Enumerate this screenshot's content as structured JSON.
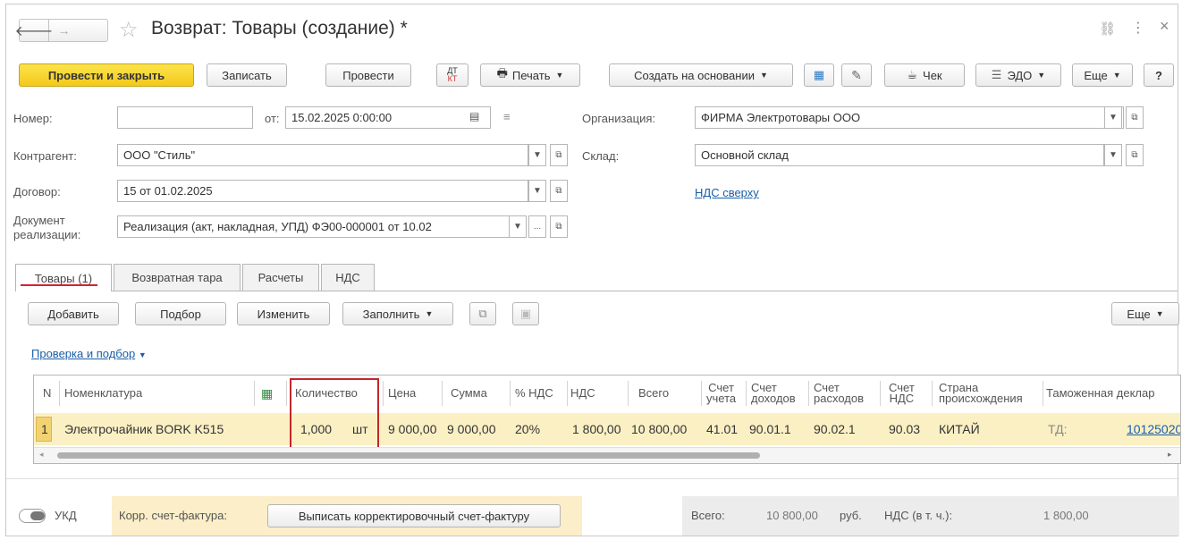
{
  "titlebar": {
    "title": "Возврат: Товары (создание) *",
    "back": "🡐",
    "forward": "→",
    "star": "☆",
    "link_icon": "⛓",
    "more_icon": "⋮",
    "close": "×"
  },
  "toolbar": {
    "post_close": "Провести и закрыть",
    "save": "Записать",
    "post": "Провести",
    "dtkt_top": "ДТ",
    "dtkt_bottom": "КТ",
    "print": "Печать",
    "create_based": "Создать на основании",
    "receipt": "Чек",
    "edo": "ЭДО",
    "more": "Еще",
    "help": "?"
  },
  "form": {
    "number_label": "Номер:",
    "number_value": "",
    "date_label": "от:",
    "date_value": "15.02.2025  0:00:00",
    "org_label": "Организация:",
    "org_value": "ФИРМА Электротовары ООО",
    "counterparty_label": "Контрагент:",
    "counterparty_value": "ООО \"Стиль\"",
    "warehouse_label": "Склад:",
    "warehouse_value": "Основной склад",
    "contract_label": "Договор:",
    "contract_value": "15 от 01.02.2025",
    "vat_link": "НДС сверху",
    "sale_doc_label_1": "Документ",
    "sale_doc_label_2": "реализации:",
    "sale_doc_value": "Реализация (акт, накладная, УПД) ФЭ00-000001 от 10.02",
    "dots": "..."
  },
  "tabs": [
    "Товары (1)",
    "Возвратная тара",
    "Расчеты",
    "НДС"
  ],
  "table_toolbar": {
    "add": "Добавить",
    "pick": "Подбор",
    "edit": "Изменить",
    "fill": "Заполнить",
    "more": "Еще",
    "check_link": "Проверка и подбор"
  },
  "table": {
    "headers": {
      "n": "N",
      "item": "Номенклатура",
      "qty": "Количество",
      "price": "Цена",
      "sum": "Сумма",
      "vat_rate": "% НДС",
      "vat": "НДС",
      "total": "Всего",
      "acc1": "Счет",
      "acc1b": "учета",
      "acc2": "Счет",
      "acc2b": "доходов",
      "acc3": "Счет",
      "acc3b": "расходов",
      "acc4": "Счет",
      "acc4b": "НДС",
      "country": "Страна",
      "countryb": "происхождения",
      "customs": "Таможенная деклар"
    },
    "rows": [
      {
        "n": "1",
        "item": "Электрочайник BORK K515",
        "qty": "1,000",
        "unit": "шт",
        "price": "9 000,00",
        "sum": "9 000,00",
        "vat_rate": "20%",
        "vat": "1 800,00",
        "total": "10 800,00",
        "acc1": "41.01",
        "acc2": "90.01.1",
        "acc3": "90.02.1",
        "acc4": "90.03",
        "country": "КИТАЙ",
        "customs_prefix": "ТД:",
        "customs_value": "10125020"
      }
    ]
  },
  "footer": {
    "ukd": "УКД",
    "corr_label": "Корр. счет-фактура:",
    "corr_button": "Выписать корректировочный счет-фактуру",
    "total_label": "Всего:",
    "total_value": "10 800,00",
    "currency": "руб.",
    "vat_label": "НДС (в т. ч.):",
    "vat_value": "1 800,00"
  },
  "colors": {
    "accent": "#f4c81b",
    "row_highlight": "#fbf0c4",
    "highlight_box": "#c0272d",
    "tab_underline": "#d2232a",
    "link": "#1a5fa8"
  }
}
